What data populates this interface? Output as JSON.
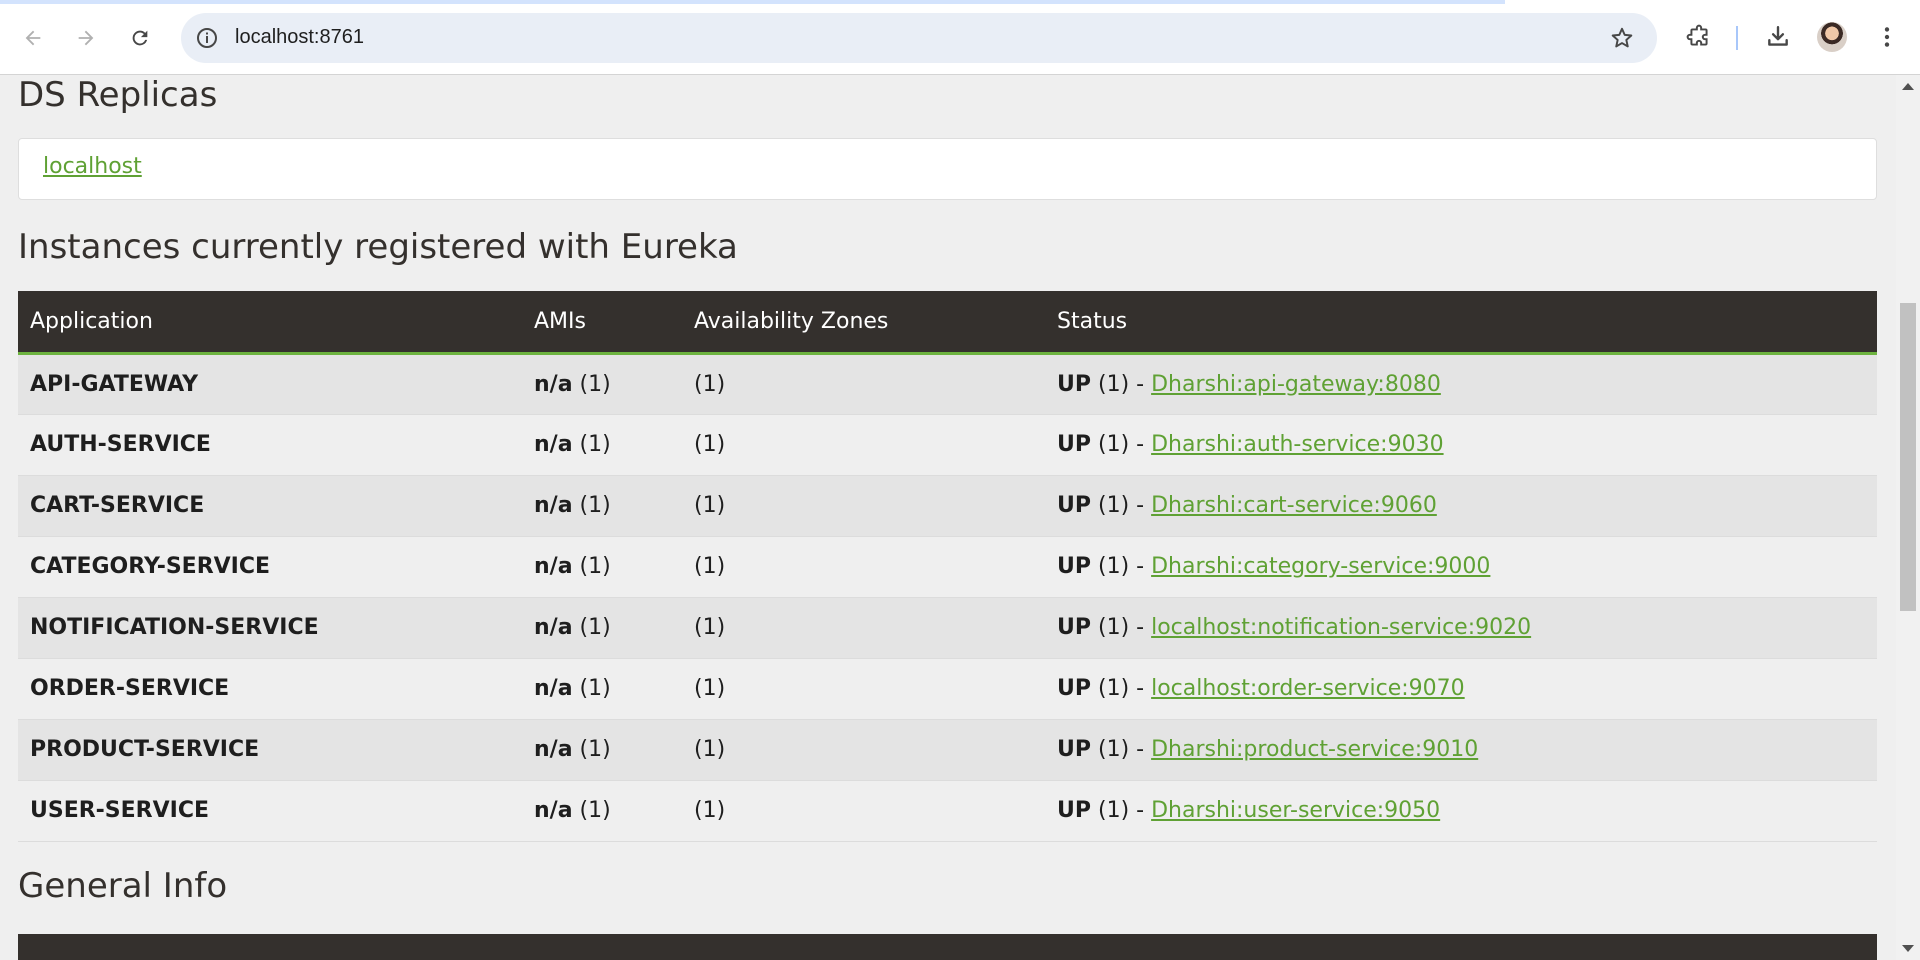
{
  "browser": {
    "url": "localhost:8761"
  },
  "replicas": {
    "heading": "DS Replicas",
    "link": "localhost"
  },
  "instances": {
    "heading": "Instances currently registered with Eureka",
    "columns": [
      "Application",
      "AMIs",
      "Availability Zones",
      "Status"
    ],
    "rows": [
      {
        "app": "API-GATEWAY",
        "ami_bold": "n/a",
        "ami_count": " (1)",
        "zones": "(1)",
        "status_bold": "UP",
        "status_text": " (1) - ",
        "instance": "Dharshi:api-gateway:8080"
      },
      {
        "app": "AUTH-SERVICE",
        "ami_bold": "n/a",
        "ami_count": " (1)",
        "zones": "(1)",
        "status_bold": "UP",
        "status_text": " (1) - ",
        "instance": "Dharshi:auth-service:9030"
      },
      {
        "app": "CART-SERVICE",
        "ami_bold": "n/a",
        "ami_count": " (1)",
        "zones": "(1)",
        "status_bold": "UP",
        "status_text": " (1) - ",
        "instance": "Dharshi:cart-service:9060"
      },
      {
        "app": "CATEGORY-SERVICE",
        "ami_bold": "n/a",
        "ami_count": " (1)",
        "zones": "(1)",
        "status_bold": "UP",
        "status_text": " (1) - ",
        "instance": "Dharshi:category-service:9000"
      },
      {
        "app": "NOTIFICATION-SERVICE",
        "ami_bold": "n/a",
        "ami_count": " (1)",
        "zones": "(1)",
        "status_bold": "UP",
        "status_text": " (1) - ",
        "instance": "localhost:notification-service:9020"
      },
      {
        "app": "ORDER-SERVICE",
        "ami_bold": "n/a",
        "ami_count": " (1)",
        "zones": "(1)",
        "status_bold": "UP",
        "status_text": " (1) - ",
        "instance": "localhost:order-service:9070"
      },
      {
        "app": "PRODUCT-SERVICE",
        "ami_bold": "n/a",
        "ami_count": " (1)",
        "zones": "(1)",
        "status_bold": "UP",
        "status_text": " (1) - ",
        "instance": "Dharshi:product-service:9010"
      },
      {
        "app": "USER-SERVICE",
        "ami_bold": "n/a",
        "ami_count": " (1)",
        "zones": "(1)",
        "status_bold": "UP",
        "status_text": " (1) - ",
        "instance": "Dharshi:user-service:9050"
      }
    ]
  },
  "general_info": {
    "heading": "General Info"
  },
  "colors": {
    "link_green": "#5fa134",
    "header_dark": "#34302d",
    "accent_green": "#6db33f"
  }
}
